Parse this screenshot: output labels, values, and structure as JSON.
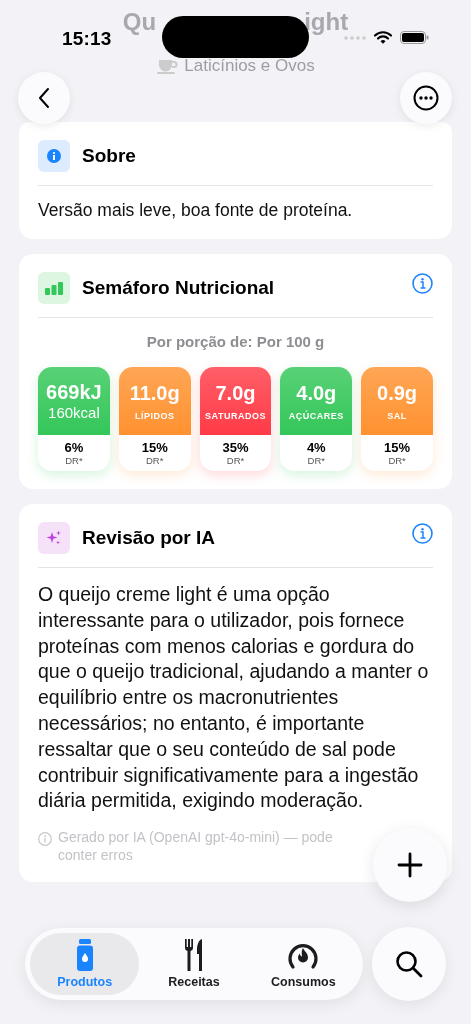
{
  "status_bar": {
    "time": "15:13"
  },
  "header": {
    "title_start": "Qu",
    "title_end": "ight",
    "subtitle": "Laticínios e Ovos"
  },
  "about": {
    "title": "Sobre",
    "text": "Versão mais leve, boa fonte de proteína."
  },
  "traffic_light": {
    "title": "Semáforo Nutricional",
    "portion": "Por porção de: Por 100 g",
    "items": [
      {
        "value": "669kJ",
        "secondary": "160kcal",
        "percent": "6%",
        "dr": "DR*",
        "color": "#34c759"
      },
      {
        "value": "11.0g",
        "label": "LÍPIDOS",
        "percent": "15%",
        "dr": "DR*",
        "color": "#ff9230"
      },
      {
        "value": "7.0g",
        "label": "SATURADOS",
        "percent": "35%",
        "dr": "DR*",
        "color": "#ff3b47"
      },
      {
        "value": "4.0g",
        "label": "AÇÚCARES",
        "percent": "4%",
        "dr": "DR*",
        "color": "#34c759"
      },
      {
        "value": "0.9g",
        "label": "SAL",
        "percent": "15%",
        "dr": "DR*",
        "color": "#ff9230"
      }
    ]
  },
  "ai_review": {
    "title": "Revisão por IA",
    "text": "O queijo creme light é uma opção interessante para o utilizador, pois fornece proteínas com menos calorias e gordura do que o queijo tradicional, ajudando a manter o equilíbrio entre os macronutrientes necessários; no entanto, é importante ressaltar que o seu conteúdo de sal pode contribuir significativamente para a ingestão diária permitida, exigindo moderação.",
    "note": "Gerado por IA (OpenAI gpt-4o-mini) — pode conter erros"
  },
  "tab_bar": {
    "tabs": [
      {
        "label": "Produtos",
        "kind": "products",
        "selected": true
      },
      {
        "label": "Receitas",
        "kind": "recipes",
        "selected": false
      },
      {
        "label": "Consumos",
        "kind": "consumption",
        "selected": false
      }
    ]
  }
}
